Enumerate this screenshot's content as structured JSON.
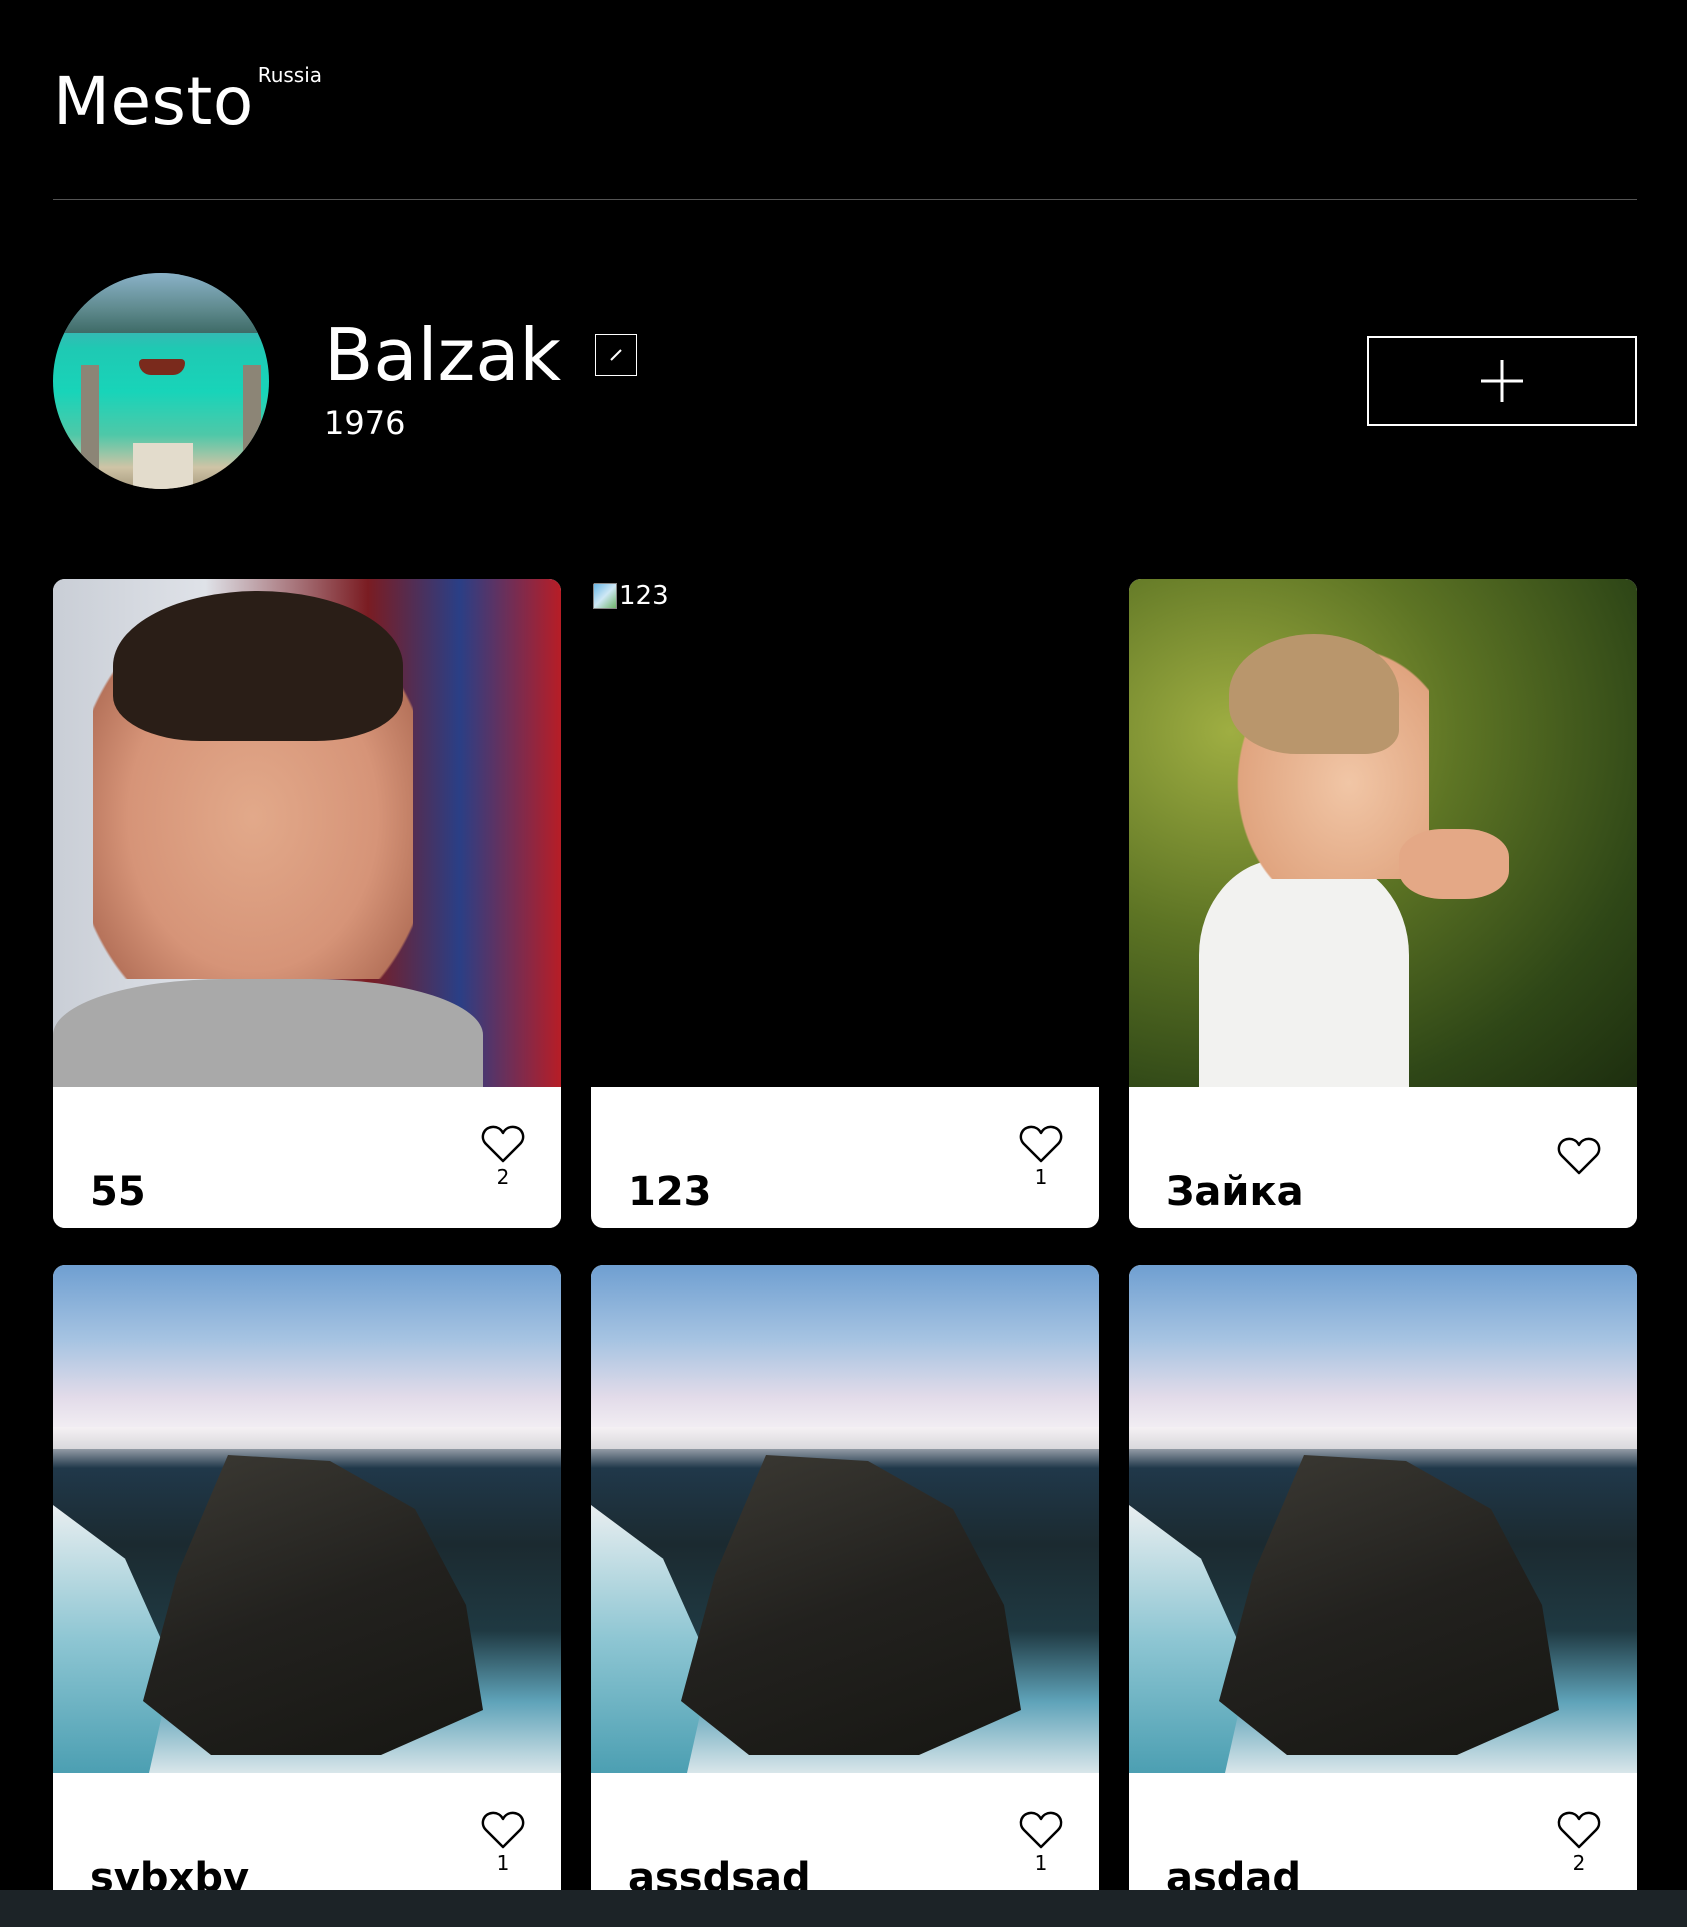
{
  "header": {
    "logo": "Mesto",
    "logo_sup": "Russia"
  },
  "profile": {
    "name": "Balzak",
    "about": "1976",
    "edit_icon": "pencil-icon",
    "add_icon": "plus-icon"
  },
  "cards": [
    {
      "title": "55",
      "likes": "2",
      "image": "portrait-photo"
    },
    {
      "title": "123",
      "likes": "1",
      "image_alt": "123"
    },
    {
      "title": "Зайка",
      "likes": "",
      "image": "child-with-chick-photo"
    },
    {
      "title": "svbxbv",
      "likes": "1",
      "image": "cliff-lake-photo"
    },
    {
      "title": "assdsad",
      "likes": "1",
      "image": "cliff-lake-photo"
    },
    {
      "title": "asdad",
      "likes": "2",
      "image": "cliff-lake-photo"
    }
  ],
  "colors": {
    "background": "#000000",
    "card": "#ffffff",
    "divider": "#545454"
  }
}
